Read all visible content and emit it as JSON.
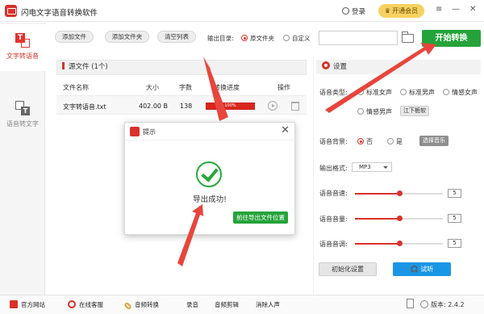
{
  "app": {
    "title": "闪电文字语音转换软件",
    "login": "登录",
    "vip": "开通会员",
    "win_menu": "≡",
    "win_min": "—",
    "win_close": "✕"
  },
  "sidebar": {
    "items": [
      {
        "label": "文字转语音",
        "icon": "text-to-voice-icon",
        "active": true
      },
      {
        "label": "语音转文字",
        "icon": "voice-to-text-icon",
        "active": false
      }
    ]
  },
  "toolbar": {
    "add_file": "添加文件",
    "add_folder": "添加文件夹",
    "clear_list": "清空列表",
    "output_dir_label": "输出目录:",
    "opt_source": "原文件夹",
    "opt_custom": "自定义",
    "path_value": "",
    "start": "开始转换"
  },
  "file_list": {
    "header": "源文件 (1个)",
    "columns": [
      "文件名称",
      "大小",
      "字数",
      "转换进度",
      "操作"
    ],
    "rows": [
      {
        "name": "文字转语音.txt",
        "size": "402.00 B",
        "chars": "138",
        "progress_text": "100%",
        "progress": 100
      }
    ]
  },
  "dialog": {
    "title": "提示",
    "close": "✕",
    "message": "导出成功!",
    "button": "前往导出文件位置"
  },
  "settings": {
    "title": "设置",
    "voice_type_label": "语音类型:",
    "voice_types": [
      "标准女声",
      "标准男声",
      "情感女声",
      "情感男声"
    ],
    "voice_extra": "江下栀软",
    "bg_label": "语音背景:",
    "bg_no": "否",
    "bg_yes": "是",
    "choose_music": "选择音乐",
    "format_label": "输出格式:",
    "format_value": "MP3",
    "speed_label": "语音音速:",
    "speed_value": "5",
    "volume_label": "语音音量:",
    "volume_value": "5",
    "pitch_label": "语音音调:",
    "pitch_value": "5",
    "slider_fraction": 0.5,
    "init_button": "初始化设置",
    "listen_button": "试听"
  },
  "bottom": {
    "website": "官方网站",
    "service": "在线客服",
    "audio_convert": "音频转换",
    "record": "录音",
    "audio_edit": "音频剪辑",
    "remove_vocal": "消除人声",
    "version": "版本: 2.4.2"
  },
  "colors": {
    "accent_red": "#d9322a",
    "green": "#25a33a",
    "blue": "#1a96e6",
    "vip_yellow": "#f7d262"
  }
}
